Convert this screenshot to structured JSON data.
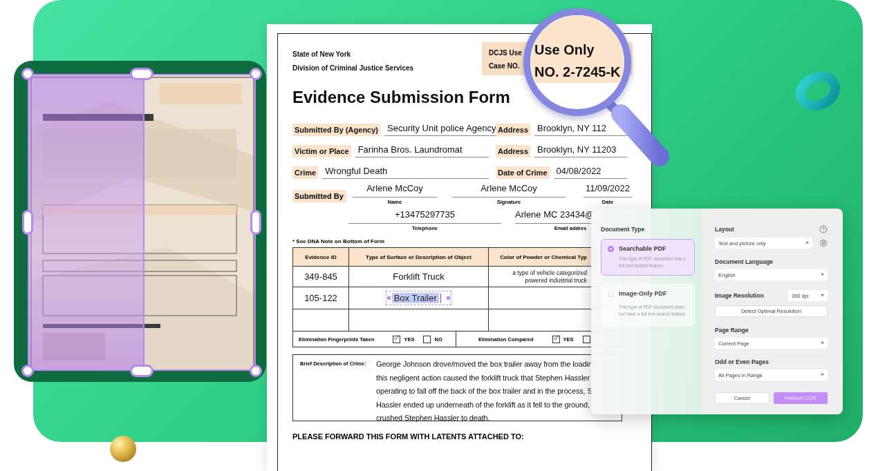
{
  "form": {
    "agency": [
      "State of New York",
      "Division of Criminal Justice Services"
    ],
    "case_box": [
      "DCJS Use",
      "Case NO."
    ],
    "title": "Evidence Submission Form",
    "fields": [
      {
        "label": "Submitted By (Agency)",
        "value": "Security Unit police Agency"
      },
      {
        "label": "Address",
        "value": "Brooklyn, NY 112"
      },
      {
        "label": "Victim or Place",
        "value": "Farinha Bros. Laundromat"
      },
      {
        "label": "Address",
        "value": "Brooklyn, NY 11203"
      },
      {
        "label": "Crime",
        "value": "Wrongful Death"
      },
      {
        "label": "Date of Crime",
        "value": "04/08/2022"
      }
    ],
    "submitter": {
      "label": "Submitted By",
      "entries": [
        {
          "value": "Arlene McCoy",
          "caption": "Name"
        },
        {
          "value": "Arlene McCoy",
          "caption": "Signature"
        },
        {
          "value": "11/09/2022",
          "caption": "Date"
        },
        {
          "value": "+13475297735",
          "caption": "Telephone"
        },
        {
          "value": "Arlene MC 23434@",
          "caption": "Email addres"
        }
      ]
    },
    "note": "* See DNA Note on Bottom of Form",
    "table": {
      "columns": [
        "Evidence ID",
        "Type of Surface or Description of Object",
        "Color of Powder or Chemical Typ"
      ],
      "rows": [
        {
          "kind": "entry",
          "evidence_id": "349-845",
          "object": {
            "text": "Forklift Truck",
            "selected": false
          },
          "powder_type_lines": [
            "a type of vehicle categorized",
            "powered industrial truck"
          ]
        },
        {
          "kind": "entry",
          "evidence_id": "105-122",
          "object": {
            "text": "Box Trailer",
            "selected": true
          }
        },
        {
          "kind": "blank"
        }
      ]
    },
    "checks": [
      {
        "label": "Elimination Fingerprints Taken",
        "options": [
          {
            "label": "YES",
            "checked": true
          },
          {
            "label": "NO",
            "checked": false
          }
        ]
      },
      {
        "label": "Elimination Compared",
        "options": [
          {
            "label": "YES",
            "checked": true
          },
          {
            "checked": false
          }
        ]
      }
    ],
    "description": {
      "label": "Brief Description of Crime:",
      "lines": [
        "George Johnson drove/moved the box trailer away from the loading",
        "this negligent action caused the forklift truck that Stephen Hassler",
        "operating to fall off the back of the box trailer and in the process, S",
        "Hassler ended up underneath of the forklift as it fell to the ground,",
        "crushed Stephen Hassler to death."
      ]
    },
    "forward": {
      "heading": "PLEASE FORWARD THIS FORM WITH LATENTS ATTACHED TO:"
    }
  },
  "magnifier": {
    "lines": [
      "Use Only",
      "NO. 2-7245-K"
    ]
  },
  "ocr_panel": {
    "document_type": {
      "label": "Document Type",
      "options": [
        {
          "title": "Searchable PDF",
          "description": "This type of PDF document has a full text search feature.",
          "selected": true
        },
        {
          "title": "Image-Only PDF",
          "description": "This type of PDF document does not have a full text search feature.",
          "selected": false
        }
      ]
    },
    "layout": {
      "label": "Layout",
      "value": "Text and picture only"
    },
    "language": {
      "label": "Document Language",
      "value": "English"
    },
    "resolution": {
      "label": "Image Resolution",
      "value": "300 dpi"
    },
    "detect_button": "Detect Optimal Resolution",
    "page_range": {
      "label": "Page Range",
      "value": "Current Page"
    },
    "odd_even": {
      "label": "Odd or Even Pages",
      "value": "All Pages in Range"
    },
    "buttons": [
      {
        "label": "Cancel",
        "kind": "secondary"
      },
      {
        "label": "Perform OCR",
        "kind": "primary"
      }
    ]
  }
}
